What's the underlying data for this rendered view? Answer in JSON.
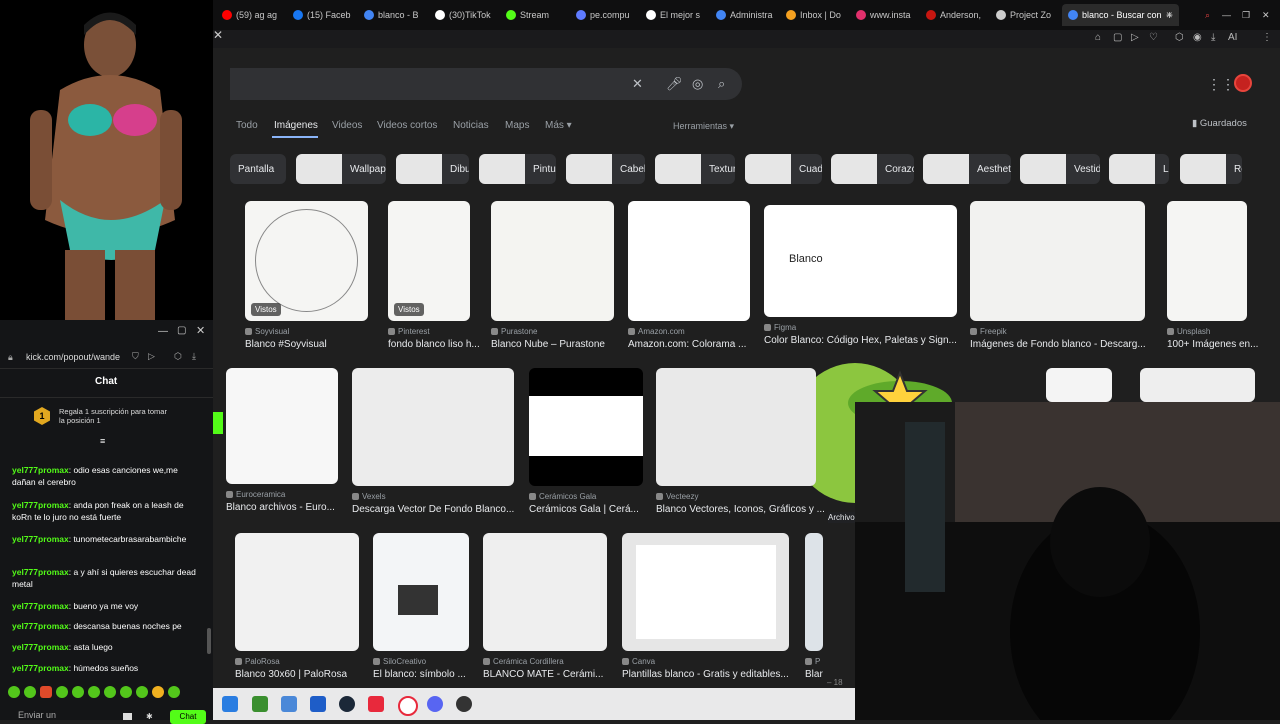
{
  "browser": {
    "tabs": [
      {
        "label": "(59) ag ag",
        "color": "#ff0000"
      },
      {
        "label": "(15) Faceb",
        "color": "#1877f2"
      },
      {
        "label": "blanco - B",
        "color": "#4285f4"
      },
      {
        "label": "(30)TikTok",
        "color": "#ffffff"
      },
      {
        "label": "Stream",
        "color": "#53fc18"
      },
      {
        "label": "pe.compu",
        "color": "#5f7bff"
      },
      {
        "label": "El mejor s",
        "color": "#ffffff"
      },
      {
        "label": "Administra",
        "color": "#4285f4"
      },
      {
        "label": "Inbox | Do",
        "color": "#f4a020"
      },
      {
        "label": "www.insta",
        "color": "#e1306c"
      },
      {
        "label": "Anderson,",
        "color": "#c71610"
      },
      {
        "label": "Project Zo",
        "color": "#cccccc"
      }
    ],
    "active_tab": "blanco - Buscar con",
    "toolbar_ai": "AI"
  },
  "google": {
    "nav": [
      "Todo",
      "Imágenes",
      "Videos",
      "Videos cortos",
      "Noticias",
      "Maps",
      "Más ▾"
    ],
    "tools": "Herramientas ▾",
    "saved": "Guardados",
    "chips": [
      "Pantalla",
      "Wallpaper",
      "Dibujo",
      "Pintura",
      "Cabello",
      "Textura",
      "Cuadro",
      "Corazon",
      "Aesthetic",
      "Vestido",
      "Luz",
      "Rosa"
    ],
    "row1": [
      {
        "src": "Soyvisual",
        "title": "Blanco #Soyvisual",
        "badge": "Vistos"
      },
      {
        "src": "Pinterest",
        "title": "fondo blanco liso h...",
        "badge": "Vistos"
      },
      {
        "src": "Purastone",
        "title": "Blanco Nube – Purastone"
      },
      {
        "src": "Amazon.com",
        "title": "Amazon.com: Colorama ..."
      },
      {
        "src": "Figma",
        "title": "Color Blanco: Código Hex, Paletas y Sign...",
        "inner": "Blanco"
      },
      {
        "src": "Freepik",
        "title": "Imágenes de Fondo blanco - Descarg..."
      },
      {
        "src": "Unsplash",
        "title": "100+ Imágenes en..."
      }
    ],
    "row2": [
      {
        "src": "Euroceramica",
        "title": "Blanco archivos - Euro..."
      },
      {
        "src": "Vexels",
        "title": "Descarga Vector De Fondo Blanco..."
      },
      {
        "src": "Cerámicos Gala",
        "title": "Cerámicos Gala | Cerá..."
      },
      {
        "src": "Vecteezy",
        "title": "Blanco Vectores, Iconos, Gráficos y ..."
      }
    ],
    "archive_label": "Archivo",
    "row3": [
      {
        "src": "PaloRosa",
        "title": "Blanco 30x60 | PaloRosa"
      },
      {
        "src": "SiloCreativo",
        "title": "El blanco: símbolo ..."
      },
      {
        "src": "Cerámica Cordillera",
        "title": "BLANCO MATE - Cerámi..."
      },
      {
        "src": "Canva",
        "title": "Plantillas blanco - Gratis y editables..."
      },
      {
        "src": "P",
        "title": "Blar"
      }
    ]
  },
  "chat": {
    "url": "kick.com/popout/wande",
    "title": "Chat",
    "gift_rank": "1",
    "gift_text": "Regala 1 suscripción para tomar la posición 1",
    "messages": [
      {
        "user": "yel777promax",
        "text": "odio esas canciones we,me dañan el cerebro"
      },
      {
        "user": "yel777promax",
        "text": "anda pon freak on a leash de koRn te lo juro no está fuerte"
      },
      {
        "user": "yel777promax",
        "text": "tunometecarbrasarabambiche"
      },
      {
        "user": "yel777promax",
        "text": "a y ahí si quieres escuchar dead metal"
      },
      {
        "user": "yel777promax",
        "text": "bueno ya me voy"
      },
      {
        "user": "yel777promax",
        "text": "descansa buenas noches pe"
      },
      {
        "user": "yel777promax",
        "text": "asta luego"
      },
      {
        "user": "yel777promax",
        "text": "húmedos sueños"
      }
    ],
    "input_placeholder": "Enviar un",
    "send_label": "Chat"
  }
}
